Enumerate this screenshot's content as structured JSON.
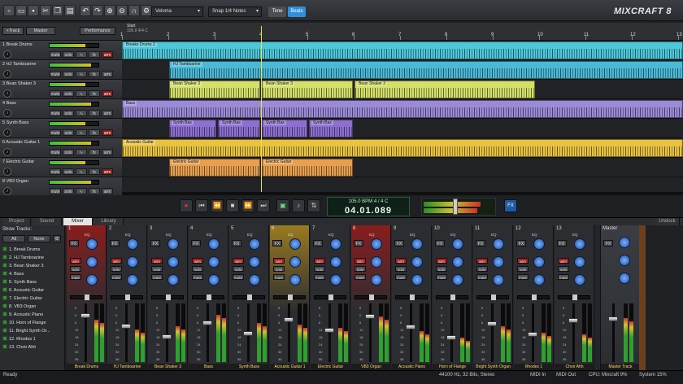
{
  "toolbar": {
    "tempo_select": "Veloma",
    "snap_select": "Snap 1/4 Notes",
    "time_btn": "Time",
    "beats_btn": "Beats",
    "logo": "MIXCRAFT 8"
  },
  "track_header": {
    "add_track": "+Track",
    "master": "Master",
    "performance": "Performance"
  },
  "ruler": {
    "marker": "Start",
    "tempo": "105.0 4/4 C",
    "bars": [
      "1",
      "2",
      "3",
      "4",
      "5",
      "6",
      "7",
      "8",
      "9",
      "10",
      "11",
      "12",
      "13"
    ]
  },
  "tracks": [
    {
      "name": "1 Break Drums",
      "color": "#4ec8d8",
      "clips": [
        {
          "label": "Breaks Drums 2",
          "start": 0,
          "end": 690
        }
      ]
    },
    {
      "name": "2 HJ Tamboarine",
      "color": "#4bb8d6",
      "clips": [
        {
          "label": "HJ Tamboarine",
          "start": 58,
          "end": 690
        }
      ]
    },
    {
      "name": "3 Bean Shaker 3",
      "color": "#d4e06a",
      "clips": [
        {
          "label": "Bean Shaker 3",
          "start": 58,
          "end": 170
        },
        {
          "label": "Bean Shaker 3",
          "start": 172,
          "end": 284
        },
        {
          "label": "Bean Shaker 3",
          "start": 286,
          "end": 508
        }
      ]
    },
    {
      "name": "4 Bass",
      "color": "#9b8bd6",
      "clips": [
        {
          "label": "Bass",
          "start": 0,
          "end": 690
        }
      ]
    },
    {
      "name": "5 Synth Bass",
      "color": "#8c6fd0",
      "clips": [
        {
          "label": "Synth Bas",
          "start": 58,
          "end": 116
        },
        {
          "label": "Synth Bas",
          "start": 118,
          "end": 170
        },
        {
          "label": "Synth Bas",
          "start": 172,
          "end": 228
        },
        {
          "label": "Synth Bas",
          "start": 230,
          "end": 284
        }
      ]
    },
    {
      "name": "6 Acoustic Guitar 1",
      "color": "#e8c341",
      "clips": [
        {
          "label": "Acoustic Guitar",
          "start": 0,
          "end": 690
        }
      ]
    },
    {
      "name": "7 Electric Guitar",
      "color": "#e6a050",
      "clips": [
        {
          "label": "Electric Guitar",
          "start": 58,
          "end": 170
        },
        {
          "label": "Electric Guitar",
          "start": 172,
          "end": 284
        }
      ]
    },
    {
      "name": "8 VB3 Organ",
      "color": "#4ec86a",
      "clips": []
    }
  ],
  "track_buttons": {
    "mute": "mute",
    "solo": "solo",
    "arm": "arm",
    "fx": "fx"
  },
  "transport": {
    "bpm_line": "105.0 BPM  4 / 4    C",
    "time": "04.01.089",
    "fx": "FX"
  },
  "tabs": [
    "Project",
    "Sound",
    "Mixer",
    "Library"
  ],
  "undock": "Undock",
  "show_tracks": {
    "title": "Show Tracks:",
    "all": "All",
    "none": "None",
    "list": [
      "1. Break Drums",
      "2. HJ Tamboarine",
      "3. Bean Shaker 3",
      "4. Bass",
      "5. Synth Bass",
      "6. Acoustic Guitar",
      "7. Electric Guitar",
      "8. VB3 Organ",
      "9. Acoustic Piano",
      "10. Horn of Flange",
      "11. Bright Synth Or...",
      "12. Rhodes 1",
      "13. Choir Ahh"
    ]
  },
  "mixer": {
    "strips": [
      {
        "num": "1",
        "name": "Break Drums",
        "accent": "#8a1d1d"
      },
      {
        "num": "2",
        "name": "HJ Tamboarine",
        "accent": "#2b2d31"
      },
      {
        "num": "3",
        "name": "Bean Shaker 3",
        "accent": "#2b2d31"
      },
      {
        "num": "4",
        "name": "Bass",
        "accent": "#2b2d31"
      },
      {
        "num": "5",
        "name": "Synth Bass",
        "accent": "#2b2d31"
      },
      {
        "num": "6",
        "name": "Acoustic Guitar 1",
        "accent": "#9a7a20"
      },
      {
        "num": "7",
        "name": "Electric Guitar",
        "accent": "#2b2d31"
      },
      {
        "num": "8",
        "name": "VB3 Organ",
        "accent": "#8a1d1d"
      },
      {
        "num": "9",
        "name": "Acoustic Piano",
        "accent": "#2b2d31"
      },
      {
        "num": "10",
        "name": "Horn of Flange",
        "accent": "#2b2d31"
      },
      {
        "num": "11",
        "name": "Bright Synth Organ",
        "accent": "#2b2d31"
      },
      {
        "num": "12",
        "name": "Rhodes 1",
        "accent": "#2b2d31"
      },
      {
        "num": "13",
        "name": "Choir Ahh",
        "accent": "#2b2d31"
      }
    ],
    "master": "Master",
    "master_name": "Master Track",
    "scale": [
      "6",
      "0",
      "6",
      "12",
      "18",
      "24",
      "30",
      "36",
      "42"
    ],
    "buttons": {
      "fx": "FX",
      "eq": "EQ",
      "arm": "arm",
      "solo": "solo",
      "mute": "mute"
    }
  },
  "status": {
    "ready": "Ready",
    "audio": "44100 Hz, 32 Bits, Stereo",
    "midi_in": "MIDI In",
    "midi_out": "MIDI Out",
    "cpu": "CPU: Mixcraft 9%",
    "system": "System 15%"
  }
}
